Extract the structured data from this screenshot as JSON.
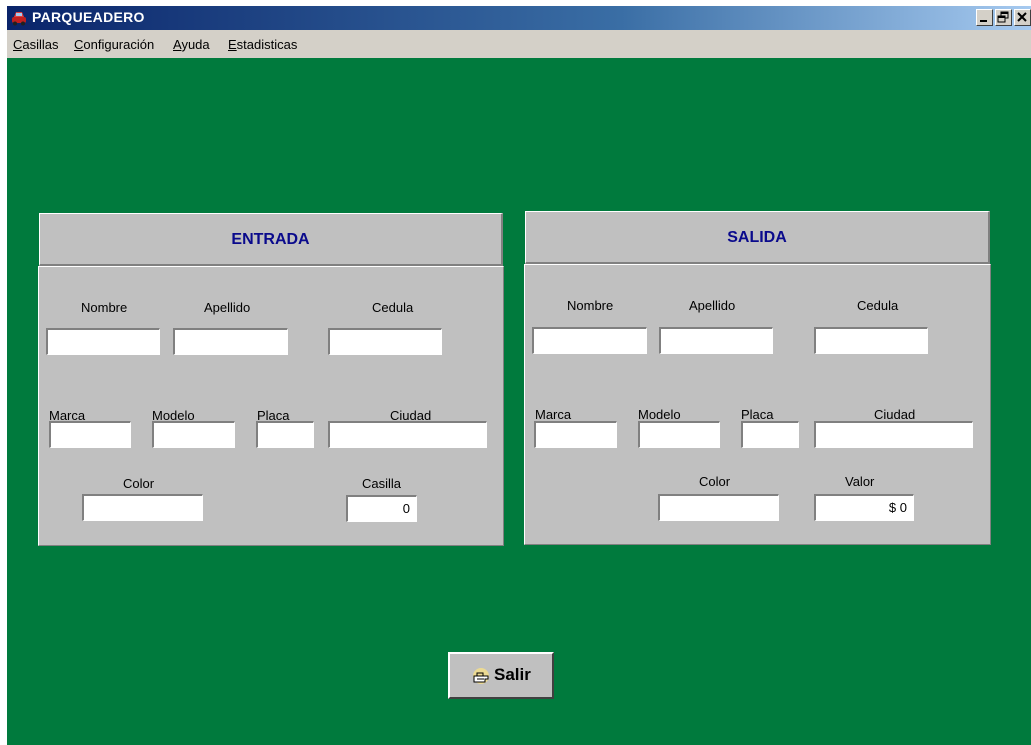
{
  "window": {
    "title": "PARQUEADERO",
    "icon": "car-icon",
    "controls": {
      "minimize": "_",
      "restore": "3",
      "close": "×"
    }
  },
  "menu": [
    {
      "label": "Casillas",
      "accel": "C",
      "rest": "asillas"
    },
    {
      "label": "Configuración",
      "accel": "C",
      "rest": "onfiguración"
    },
    {
      "label": "Ayuda",
      "accel": "A",
      "rest": "yuda"
    },
    {
      "label": "Estadisticas",
      "accel": "E",
      "rest": "stadisticas"
    }
  ],
  "entrada": {
    "title": "ENTRADA",
    "labels": {
      "nombre": "Nombre",
      "apellido": "Apellido",
      "cedula": "Cedula",
      "marca": "Marca",
      "modelo": "Modelo",
      "placa": "Placa",
      "ciudad": "Ciudad",
      "color": "Color",
      "casilla": "Casilla"
    },
    "values": {
      "nombre": "",
      "apellido": "",
      "cedula": "",
      "marca": "",
      "modelo": "",
      "placa": "",
      "ciudad": "",
      "color": "",
      "casilla": "0"
    }
  },
  "salida": {
    "title": "SALIDA",
    "labels": {
      "nombre": "Nombre",
      "apellido": "Apellido",
      "cedula": "Cedula",
      "marca": "Marca",
      "modelo": "Modelo",
      "placa": "Placa",
      "ciudad": "Ciudad",
      "color": "Color",
      "valor": "Valor"
    },
    "values": {
      "nombre": "",
      "apellido": "",
      "cedula": "",
      "marca": "",
      "modelo": "",
      "placa": "",
      "ciudad": "",
      "color": "",
      "valor": "$ 0"
    }
  },
  "exit_button": {
    "label": "Salir",
    "icon": "exit-hand-icon"
  },
  "colors": {
    "background": "#007a3d",
    "panel": "#c0c0c0",
    "heading": "#0a0a8c",
    "titlebar": "#0a246a"
  }
}
